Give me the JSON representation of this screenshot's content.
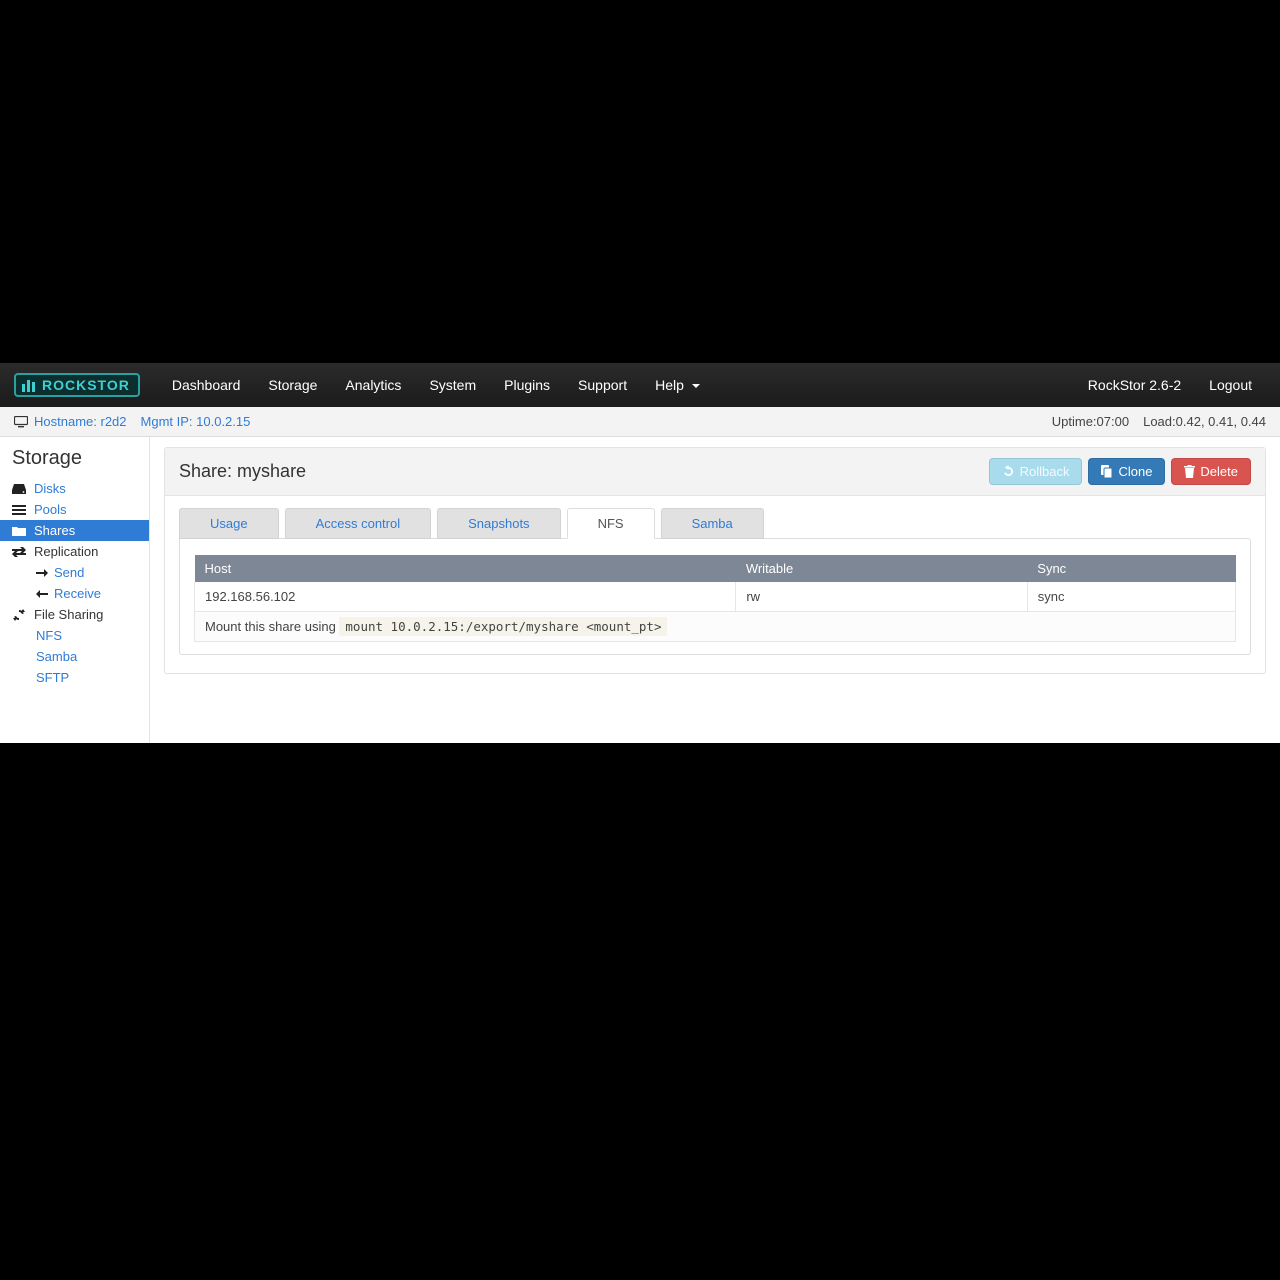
{
  "brand": {
    "name": "ROCKSTOR"
  },
  "nav": {
    "items": [
      {
        "label": "Dashboard"
      },
      {
        "label": "Storage"
      },
      {
        "label": "Analytics"
      },
      {
        "label": "System"
      },
      {
        "label": "Plugins"
      },
      {
        "label": "Support"
      },
      {
        "label": "Help"
      }
    ],
    "version": "RockStor 2.6-2",
    "logout": "Logout"
  },
  "infobar": {
    "hostname_label": "Hostname: ",
    "hostname": "r2d2",
    "mgmt_ip_label": "Mgmt IP: ",
    "mgmt_ip": "10.0.2.15",
    "uptime_label": "Uptime: ",
    "uptime": "07:00",
    "load_label": "Load: ",
    "load": "0.42, 0.41, 0.44"
  },
  "sidebar": {
    "title": "Storage",
    "items": [
      {
        "label": "Disks"
      },
      {
        "label": "Pools"
      },
      {
        "label": "Shares"
      },
      {
        "label": "Replication"
      },
      {
        "label": "Send"
      },
      {
        "label": "Receive"
      },
      {
        "label": "File Sharing"
      },
      {
        "label": "NFS"
      },
      {
        "label": "Samba"
      },
      {
        "label": "SFTP"
      }
    ]
  },
  "share": {
    "title_prefix": "Share: ",
    "name": "myshare",
    "buttons": {
      "rollback": "Rollback",
      "clone": "Clone",
      "delete": "Delete"
    },
    "tabs": [
      {
        "label": "Usage"
      },
      {
        "label": "Access control"
      },
      {
        "label": "Snapshots"
      },
      {
        "label": "NFS"
      },
      {
        "label": "Samba"
      }
    ],
    "nfs_table": {
      "headers": {
        "host": "Host",
        "writable": "Writable",
        "sync": "Sync"
      },
      "rows": [
        {
          "host": "192.168.56.102",
          "writable": "rw",
          "sync": "sync"
        }
      ],
      "mount_prefix": "Mount this share using ",
      "mount_cmd": "mount 10.0.2.15:/export/myshare <mount_pt>"
    }
  }
}
